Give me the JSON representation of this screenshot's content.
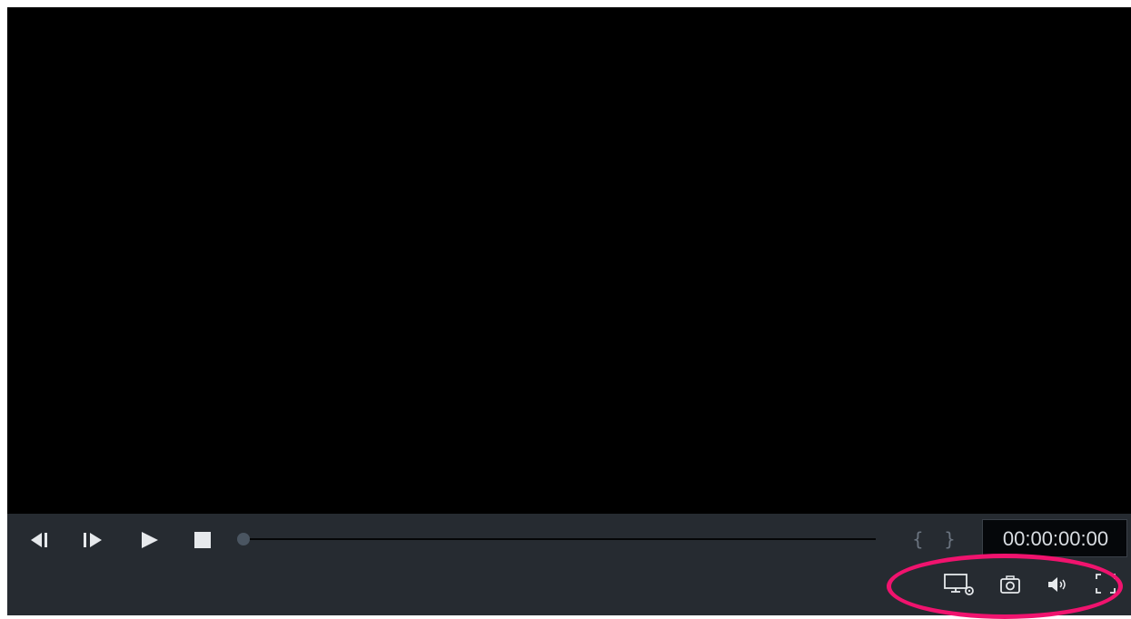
{
  "player": {
    "timecode": "00:00:00:00",
    "braces": "{ }",
    "progress": 0
  },
  "controls": {
    "step_back": "step-back-icon",
    "step_forward": "step-forward-icon",
    "play": "play-icon",
    "stop": "stop-icon",
    "display_settings": "display-settings-icon",
    "snapshot": "camera-icon",
    "volume": "volume-icon",
    "fullscreen": "fullscreen-icon"
  },
  "colors": {
    "controls_bg": "#262b31",
    "video_bg": "#000000",
    "icon": "#e6e9ec",
    "highlight": "#f0136e"
  }
}
